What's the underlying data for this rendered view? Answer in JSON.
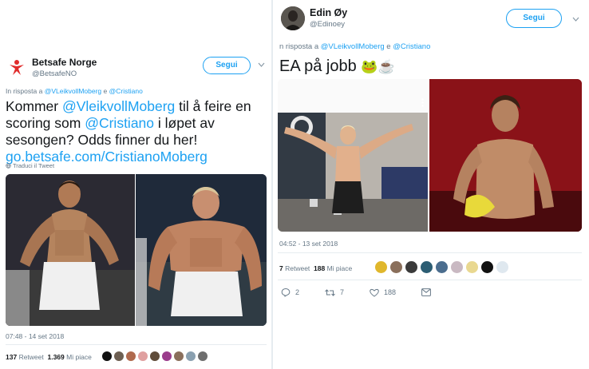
{
  "left": {
    "name": "Betsafe Norge",
    "handle": "@BetsafeNO",
    "follow": "Segui",
    "reply_prefix": "In risposta a",
    "reply_user1": "@VLeikvollMoberg",
    "reply_and": "e",
    "reply_user2": "@Cristiano",
    "text_1": "Kommer ",
    "mention_1": "@VleikvollMoberg",
    "text_2": " til å feire en scoring som ",
    "mention_2": "@Cristiano",
    "text_3": " i løpet av sesongen? Odds finner du her!",
    "link": "go.betsafe.com/CristianoMoberg",
    "translate": "Traduci il Tweet",
    "time": "07:48 - 14 set 2018",
    "retweets": "137",
    "retweets_label": "Retweet",
    "likes": "1.369",
    "likes_label": "Mi piace"
  },
  "right": {
    "name": "Edin Øy",
    "handle": "@Edinoey",
    "follow": "Segui",
    "reply_prefix": "n risposta a",
    "reply_user1": "@VLeikvollMoberg",
    "reply_and": "e",
    "reply_user2": "@Cristiano",
    "text": "EA på jobb",
    "emoji": "🐸☕",
    "time": "04:52 - 13 set 2018",
    "retweets": "7",
    "retweets_label": "Retweet",
    "likes": "188",
    "likes_label": "Mi piace",
    "reply_count": "2",
    "retweet_count": "7",
    "like_count": "188"
  },
  "icons": {
    "logo": "betsafe-logo-icon",
    "chevron": "chevron-down-icon",
    "globe": "globe-icon",
    "reply": "reply-icon",
    "retweet": "retweet-icon",
    "like": "heart-icon",
    "message": "direct-message-icon",
    "more": "more-dots-icon"
  },
  "colors": {
    "accent": "#1da1f2",
    "text": "#14171a",
    "muted": "#657786",
    "betsafe_red": "#e02b2b"
  }
}
